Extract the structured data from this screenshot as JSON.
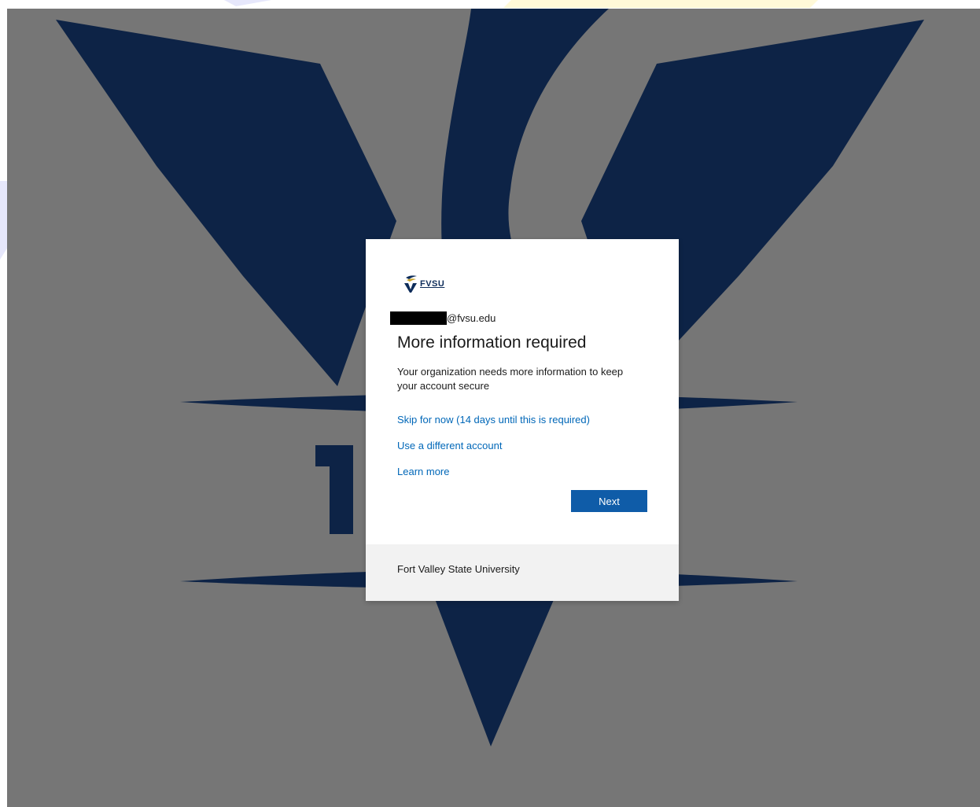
{
  "colors": {
    "backdrop": "#767676",
    "emblem_navy": "#0d2346",
    "accent_blue": "#0067b8",
    "button_blue": "#0f5ca8",
    "footer_bg": "#f2f2f2",
    "page_accent_lavender": "#e6e7fb",
    "page_accent_yellow": "#fff9d8"
  },
  "logo": {
    "icon": "fvsu-wildcat-icon",
    "text": "FVSU"
  },
  "identity": {
    "redacted": true,
    "domain_text": "@fvsu.edu"
  },
  "title": "More information required",
  "description": "Your organization needs more information to keep your account secure",
  "links": {
    "skip": "Skip for now (14 days until this is required)",
    "different_account": "Use a different account",
    "learn_more": "Learn more"
  },
  "buttons": {
    "next": "Next"
  },
  "footer": {
    "org_name": "Fort Valley State University"
  }
}
